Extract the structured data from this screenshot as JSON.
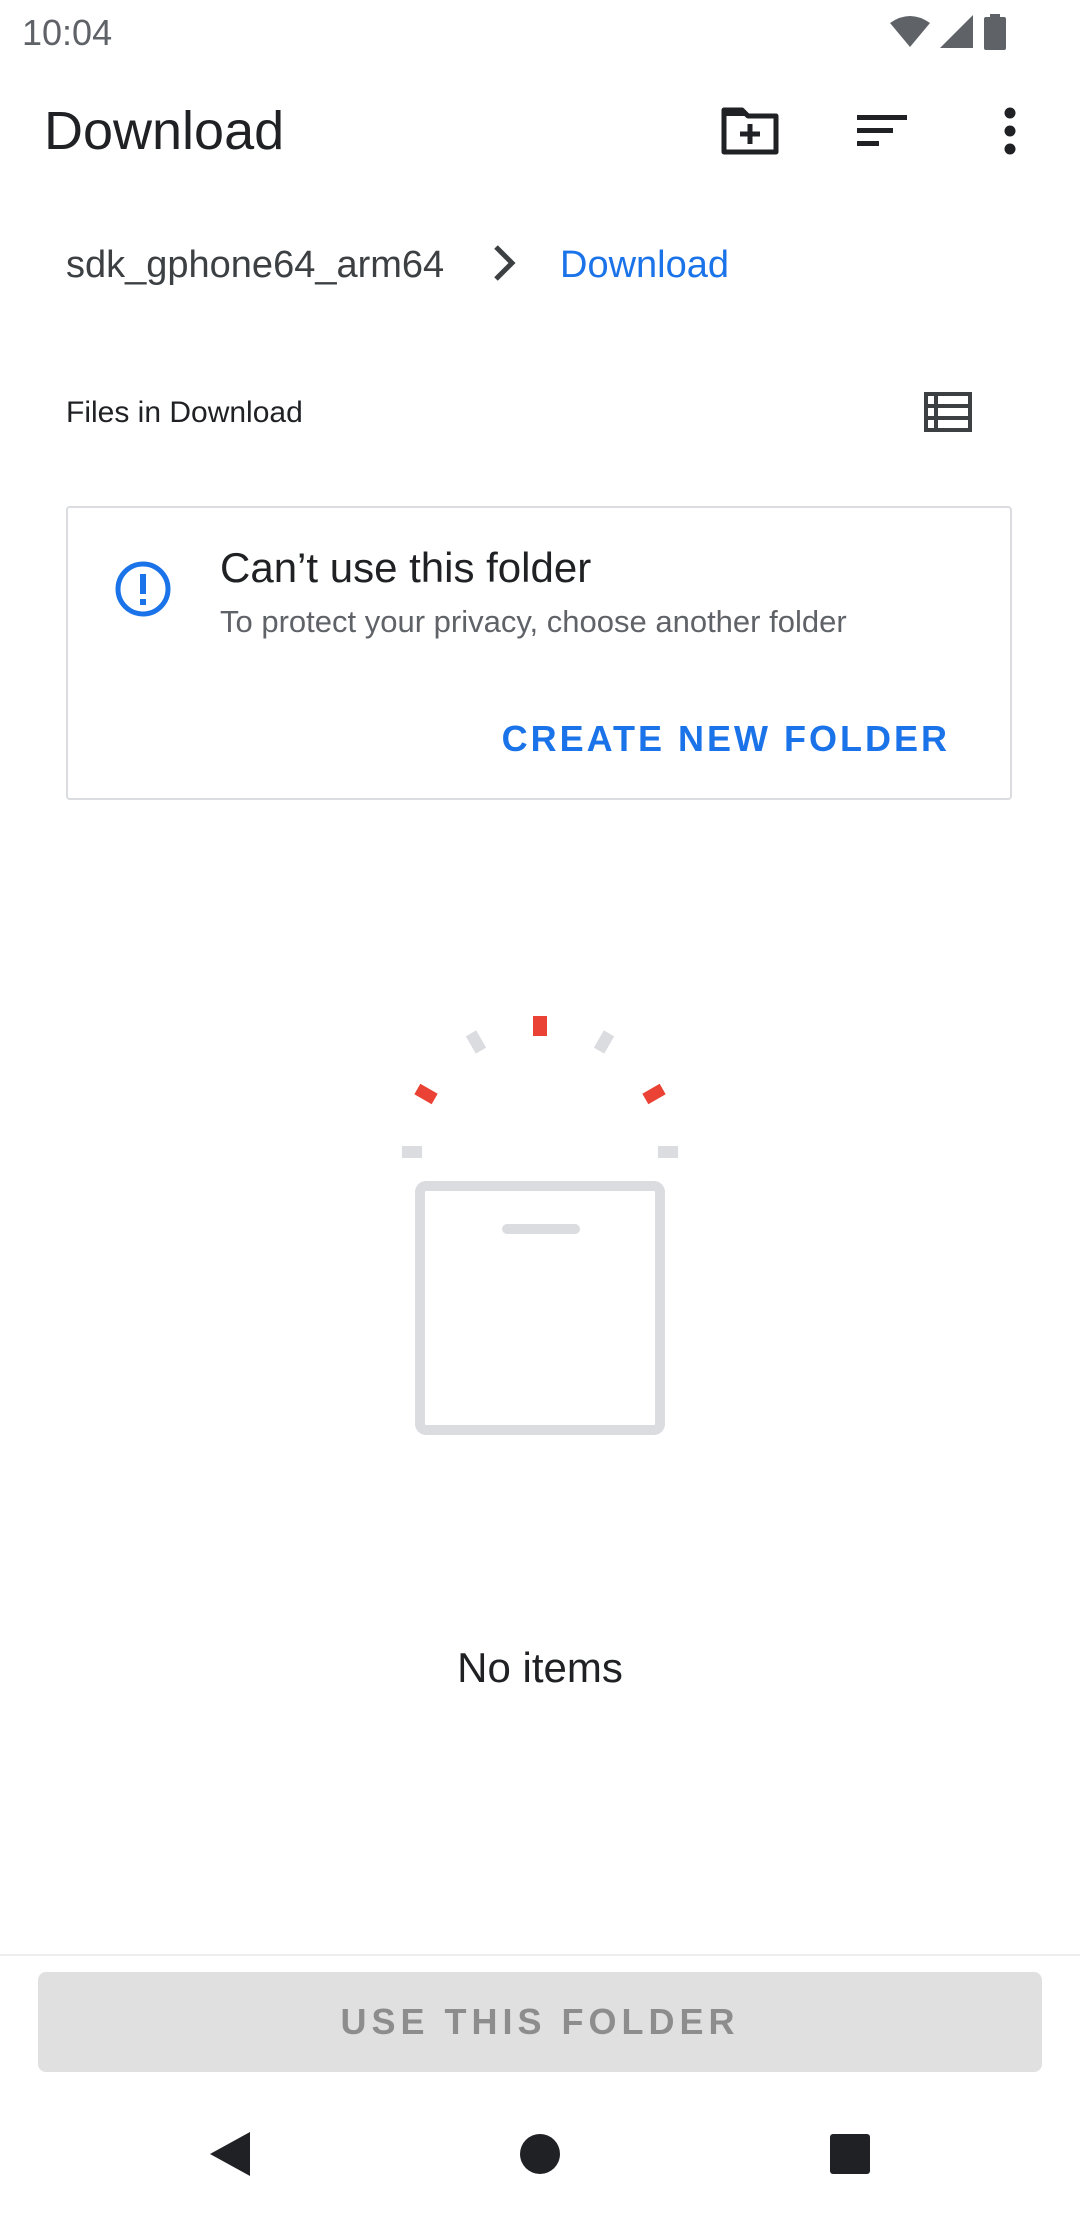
{
  "status_bar": {
    "time": "10:04",
    "icons": [
      "wifi-icon",
      "cell-signal-icon",
      "battery-icon"
    ]
  },
  "app_bar": {
    "title": "Download",
    "actions": [
      "new-folder-icon",
      "sort-icon",
      "more-vert-icon"
    ]
  },
  "breadcrumb": {
    "root": "sdk_gphone64_arm64",
    "current": "Download"
  },
  "files_header": "Files in Download",
  "warning_card": {
    "title": "Can’t use this folder",
    "subtitle": "To protect your privacy, choose another folder",
    "action": "CREATE NEW FOLDER"
  },
  "empty_state": {
    "text": "No items"
  },
  "primary_button": {
    "label": "USE THIS FOLDER",
    "enabled": false
  },
  "colors": {
    "accent": "#1a73e8",
    "illustration_red": "#ea4335",
    "illustration_gray": "#dadce0"
  },
  "nav_bar": [
    "back-icon",
    "home-icon",
    "recents-icon"
  ]
}
